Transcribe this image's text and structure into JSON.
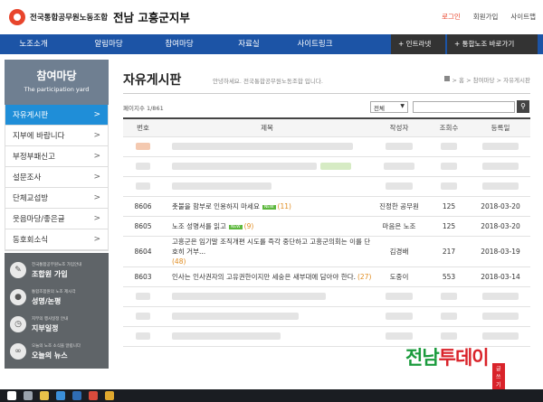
{
  "header": {
    "org_name": "전국통합공무원노동조합",
    "branch_name": "전남 고흥군지부",
    "util_links": [
      "로그인",
      "회원가입",
      "사이트맵"
    ]
  },
  "gnb": {
    "items": [
      "노조소개",
      "알림마당",
      "참여마당",
      "자료실",
      "사이트링크"
    ],
    "quick_links": [
      "+ 인트라넷",
      "+ 통합노조 바로가기"
    ]
  },
  "sidebar": {
    "title": "참여마당",
    "subtitle": "The participation yard",
    "items": [
      "자유게시판",
      "지부에 바랍니다",
      "부정부패신고",
      "설문조사",
      "단체교섭방",
      "웃음마당/좋은글",
      "동호회소식"
    ],
    "active_index": 0,
    "links": [
      {
        "small": "전국통합공무원노조 가입안내",
        "big": "조합원 가입",
        "icon": "pen-icon"
      },
      {
        "small": "통합조합원의 노조 제시각",
        "big": "성명/논평",
        "icon": "microphone-icon"
      },
      {
        "small": "지부의 행사일정 안내",
        "big": "지부일정",
        "icon": "clock-icon"
      },
      {
        "small": "오늘의 노조 소식을 알립니다",
        "big": "오늘의 뉴스",
        "icon": "link-icon"
      }
    ]
  },
  "content": {
    "title": "자유게시판",
    "greeting": "안녕하세요. 전국통합공무원노동조합 입니다.",
    "breadcrumb": "> 홈 > 참여마당 > 자유게시판",
    "page_count": "페이지수 1/861",
    "search_scope": "전체",
    "search_placeholder": ""
  },
  "board": {
    "headers": [
      "번호",
      "제목",
      "작성자",
      "조회수",
      "등록일"
    ],
    "posts": [
      {
        "no": "8606",
        "title": "촛불을 함부로 인용하지 마세요",
        "new": "NEW",
        "comments": "(11)",
        "writer": "진정한 공무원",
        "hits": "125",
        "date": "2018-03-20"
      },
      {
        "no": "8605",
        "title": "노조 성명서를 읽고",
        "new": "NEW",
        "comments": "(9)",
        "writer": "마음은 노조",
        "hits": "125",
        "date": "2018-03-20"
      },
      {
        "no": "8604",
        "title": "고흥군은 임기말 조직개편 시도를 즉각 중단하고 고흥군의회는 이를 단호히 거부...",
        "new": "",
        "comments": "(48)",
        "writer": "김경배",
        "hits": "217",
        "date": "2018-03-19"
      },
      {
        "no": "8603",
        "title": "인사는 인사권자의 고유권한이지만 세숭은 새부대에 담아야 한다.",
        "new": "",
        "comments": "(27)",
        "writer": "도중이",
        "hits": "553",
        "date": "2018-03-14"
      }
    ]
  },
  "watermark": {
    "brand_a": "전남",
    "brand_b": "투데이",
    "tag": "글쓰기"
  },
  "colors": {
    "nav_blue": "#1c54a6",
    "active_blue": "#1f8ed8",
    "accent_red": "#e8452c",
    "sidebar_gray": "#6f7f91"
  }
}
